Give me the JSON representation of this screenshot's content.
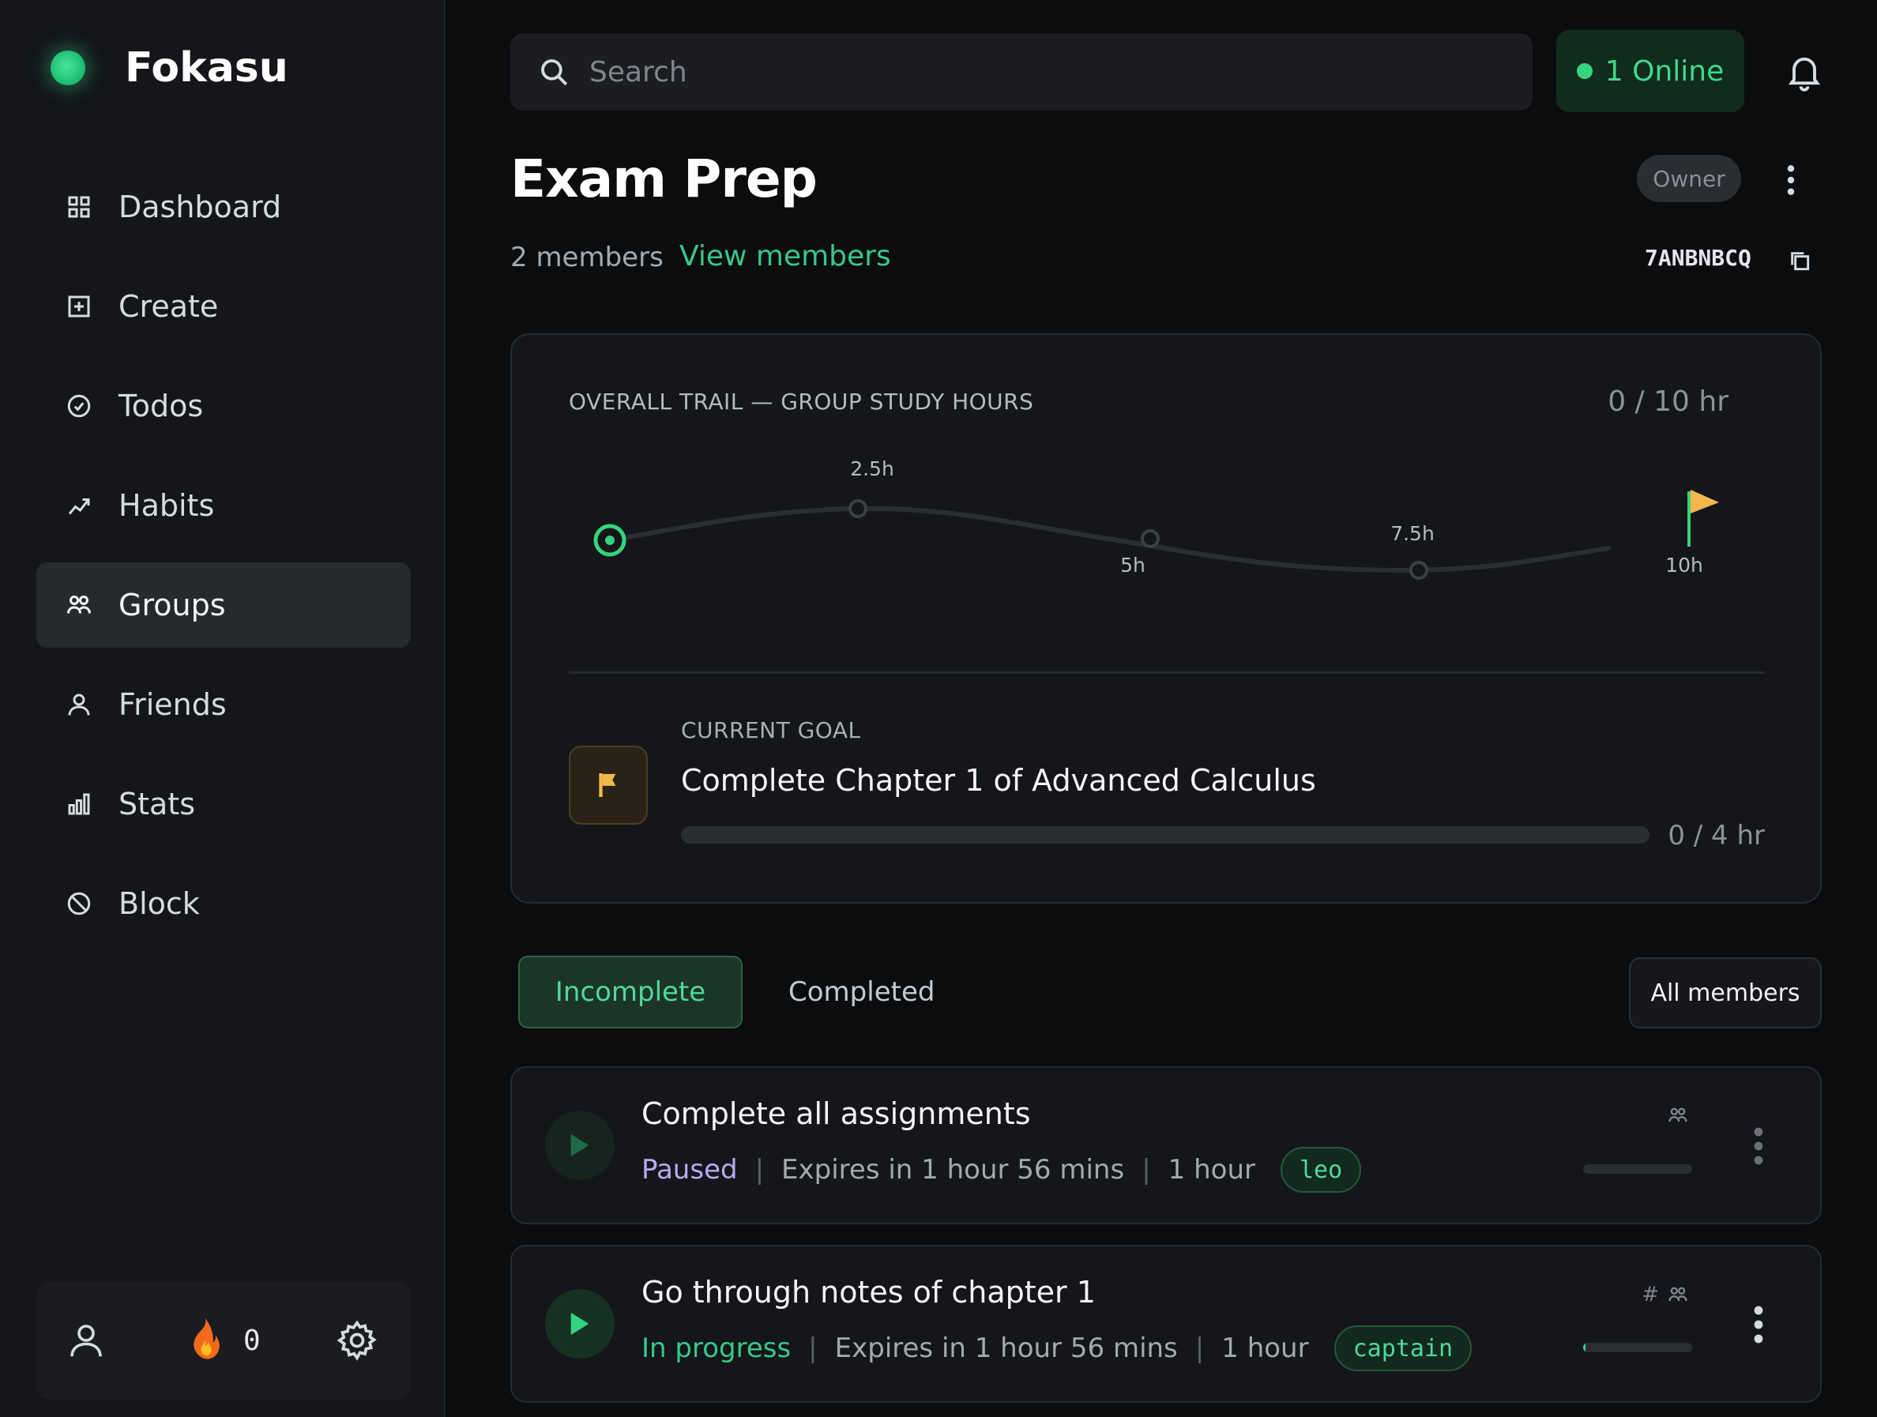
{
  "brand": {
    "name": "Fokasu"
  },
  "sidebar": {
    "items": [
      {
        "label": "Dashboard",
        "icon": "grid-icon",
        "active": false
      },
      {
        "label": "Create",
        "icon": "plus-square-icon",
        "active": false
      },
      {
        "label": "Todos",
        "icon": "check-circle-icon",
        "active": false
      },
      {
        "label": "Habits",
        "icon": "trend-icon",
        "active": false
      },
      {
        "label": "Groups",
        "icon": "users-icon",
        "active": true
      },
      {
        "label": "Friends",
        "icon": "user-icon",
        "active": false
      },
      {
        "label": "Stats",
        "icon": "bar-chart-icon",
        "active": false
      },
      {
        "label": "Block",
        "icon": "block-icon",
        "active": false
      }
    ],
    "footer": {
      "streak": "0"
    }
  },
  "topbar": {
    "search_placeholder": "Search",
    "online_label": "1 Online"
  },
  "group": {
    "title": "Exam Prep",
    "role": "Owner",
    "members_count": "2 members",
    "view_members": "View members",
    "invite_code": "7ANBNBCQ"
  },
  "trail": {
    "title": "OVERALL TRAIL — GROUP STUDY HOURS",
    "total": "0 / 10 hr",
    "progress_hours": 0,
    "milestones": [
      "2.5h",
      "5h",
      "7.5h",
      "10h"
    ]
  },
  "goal": {
    "label": "CURRENT GOAL",
    "name": "Complete Chapter 1 of Advanced Calculus",
    "progress_text": "0 / 4 hr",
    "progress_fraction": 0
  },
  "filters": {
    "incomplete": "Incomplete",
    "completed": "Completed",
    "members": "All members"
  },
  "tasks": [
    {
      "title": "Complete all assignments",
      "status": "Paused",
      "expires": "Expires in 1 hour 56 mins",
      "duration": "1 hour",
      "tag": "leo",
      "progress_fraction": 0
    },
    {
      "title": "Go through notes of chapter 1",
      "status": "In progress",
      "expires": "Expires in 1 hour 56 mins",
      "duration": "1 hour",
      "tag": "captain",
      "hash": "#",
      "progress_fraction": 0.02
    }
  ],
  "colors": {
    "accent": "#34d37f",
    "background": "#0b0c0e",
    "sidebar": "#141619",
    "paused": "#b9a9f2",
    "goal_flag": "#f2b84b"
  }
}
